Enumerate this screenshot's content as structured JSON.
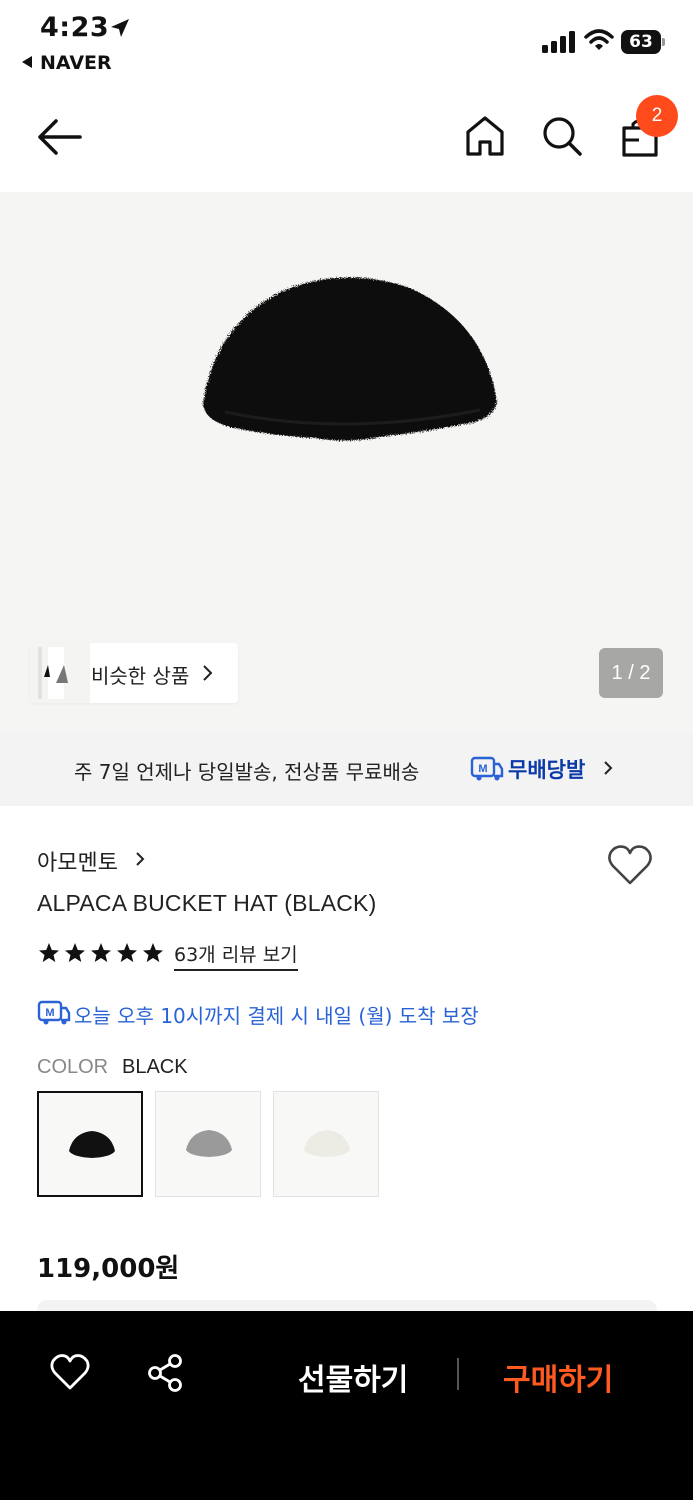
{
  "status_bar": {
    "time": "4:23",
    "back_app": "NAVER",
    "battery": "63"
  },
  "header": {
    "cart_count": "2"
  },
  "gallery": {
    "similar_label": "비슷한 상품",
    "page_indicator": "1 / 2"
  },
  "delivery": {
    "text": "주 7일 언제나 당일발송, 전상품 무료배송",
    "brand": "무배당발"
  },
  "product": {
    "brand": "아모멘토",
    "title": "ALPACA BUCKET HAT (BLACK)",
    "rating_stars": 5,
    "review_link": "63개 리뷰 보기",
    "arrival": "오늘 오후 10시까지 결제 시 내일 (월) 도착 보장",
    "color_label": "COLOR",
    "color_value": "BLACK",
    "swatches": [
      {
        "name": "black",
        "color": "#111111",
        "selected": true
      },
      {
        "name": "gray",
        "color": "#9a9a9a",
        "selected": false
      },
      {
        "name": "ivory",
        "color": "#ecebe4",
        "selected": false
      }
    ],
    "price": "119,000원"
  },
  "bottom_bar": {
    "gift_label": "선물하기",
    "buy_label": "구매하기"
  },
  "colors": {
    "accent": "#ff5a1f",
    "badge": "#ff4a1c",
    "delivery_brand": "#0b3aa8",
    "arrival_text": "#2a63d6"
  }
}
